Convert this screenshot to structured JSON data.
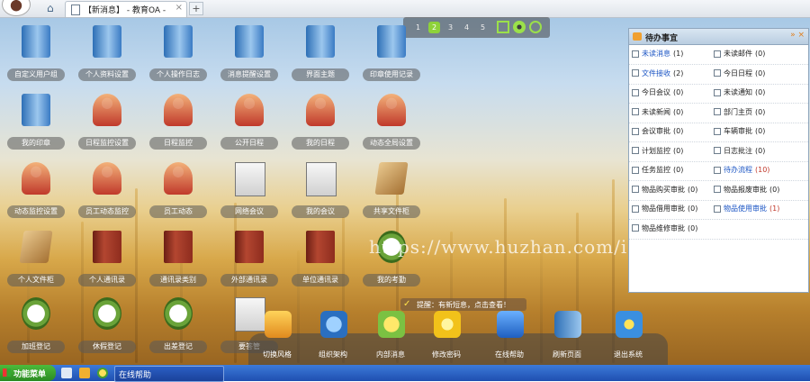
{
  "browser": {
    "tab_title": "【新消息】 - 教育OA - ",
    "tab_close": "×",
    "new_tab": "+",
    "home_glyph": "⌂"
  },
  "pager": {
    "pages": [
      "1",
      "2",
      "3",
      "4",
      "5"
    ],
    "active": "2",
    "icons": [
      "grid-icon",
      "gear-icon",
      "search-icon"
    ]
  },
  "desktop_icons": [
    {
      "label": "自定义用户组",
      "icon": "user-icon"
    },
    {
      "label": "个人资料设置",
      "icon": "user-icon"
    },
    {
      "label": "个人操作日志",
      "icon": "user-icon"
    },
    {
      "label": "消息提醒设置",
      "icon": "user-icon"
    },
    {
      "label": "界面主题",
      "icon": "user-icon"
    },
    {
      "label": "印章使用记录",
      "icon": "user-icon"
    },
    {
      "label": "我的印章",
      "icon": "user-icon"
    },
    {
      "label": "日程监控设置",
      "icon": "people-icon"
    },
    {
      "label": "日程监控",
      "icon": "people-icon"
    },
    {
      "label": "公开日程",
      "icon": "people-icon"
    },
    {
      "label": "我的日程",
      "icon": "people-icon"
    },
    {
      "label": "动态全局设置",
      "icon": "people-icon"
    },
    {
      "label": "动态监控设置",
      "icon": "people-icon"
    },
    {
      "label": "员工动态监控",
      "icon": "people-icon"
    },
    {
      "label": "员工动态",
      "icon": "people-icon"
    },
    {
      "label": "网络会议",
      "icon": "meeting-icon"
    },
    {
      "label": "我的会议",
      "icon": "meeting-icon"
    },
    {
      "label": "共享文件柜",
      "icon": "cabinet-icon"
    },
    {
      "label": "个人文件柜",
      "icon": "cabinet-icon"
    },
    {
      "label": "个人通讯录",
      "icon": "addressbook-icon"
    },
    {
      "label": "通讯录类别",
      "icon": "addressbook-icon"
    },
    {
      "label": "外部通讯录",
      "icon": "addressbook-icon"
    },
    {
      "label": "单位通讯录",
      "icon": "addressbook-icon"
    },
    {
      "label": "我的考勤",
      "icon": "clock-icon"
    },
    {
      "label": "加班登记",
      "icon": "clock-icon"
    },
    {
      "label": "休假登记",
      "icon": "clock-icon"
    },
    {
      "label": "出差登记",
      "icon": "clock-icon"
    },
    {
      "label": "要答管",
      "icon": "pen-icon"
    }
  ],
  "todo_panel": {
    "title": "待办事宜",
    "controls": "» ×",
    "items": [
      {
        "name": "未读消息",
        "count": "(1)",
        "link": true,
        "red": false
      },
      {
        "name": "未读邮件",
        "count": "(0)",
        "link": false,
        "red": false
      },
      {
        "name": "文件接收",
        "count": "(2)",
        "link": true,
        "red": false
      },
      {
        "name": "今日日程",
        "count": "(0)",
        "link": false,
        "red": false
      },
      {
        "name": "今日会议",
        "count": "(0)",
        "link": false,
        "red": false
      },
      {
        "name": "未读通知",
        "count": "(0)",
        "link": false,
        "red": false
      },
      {
        "name": "未读新闻",
        "count": "(0)",
        "link": false,
        "red": false
      },
      {
        "name": "部门主页",
        "count": "(0)",
        "link": false,
        "red": false
      },
      {
        "name": "会议审批",
        "count": "(0)",
        "link": false,
        "red": false
      },
      {
        "name": "车辆审批",
        "count": "(0)",
        "link": false,
        "red": false
      },
      {
        "name": "计划监控",
        "count": "(0)",
        "link": false,
        "red": false
      },
      {
        "name": "日志批注",
        "count": "(0)",
        "link": false,
        "red": false
      },
      {
        "name": "任务监控",
        "count": "(0)",
        "link": false,
        "red": false
      },
      {
        "name": "待办流程",
        "count": "(10)",
        "link": true,
        "red": true
      },
      {
        "name": "物品购买审批",
        "count": "(0)",
        "link": false,
        "red": false
      },
      {
        "name": "物品报废审批",
        "count": "(0)",
        "link": false,
        "red": false
      },
      {
        "name": "物品借用审批",
        "count": "(0)",
        "link": false,
        "red": false
      },
      {
        "name": "物品使用审批",
        "count": "(1)",
        "link": true,
        "red": true
      },
      {
        "name": "物品维修审批",
        "count": "(0)",
        "link": false,
        "red": false
      }
    ]
  },
  "watermark": "https://www.huzhan.com/ishop3572",
  "notification": "提醒：有新短息，点击查看！",
  "dock": [
    {
      "label": "切换风格",
      "icon": "style-icon"
    },
    {
      "label": "组织架构",
      "icon": "org-icon"
    },
    {
      "label": "内部消息",
      "icon": "message-icon"
    },
    {
      "label": "修改密码",
      "icon": "star-icon"
    },
    {
      "label": "在线帮助",
      "icon": "help-icon"
    },
    {
      "label": "刷新页面",
      "icon": "refresh-icon"
    },
    {
      "label": "退出系统",
      "icon": "exit-icon"
    }
  ],
  "taskbar": {
    "start_label": "功能菜单",
    "help_label": "在线帮助"
  }
}
